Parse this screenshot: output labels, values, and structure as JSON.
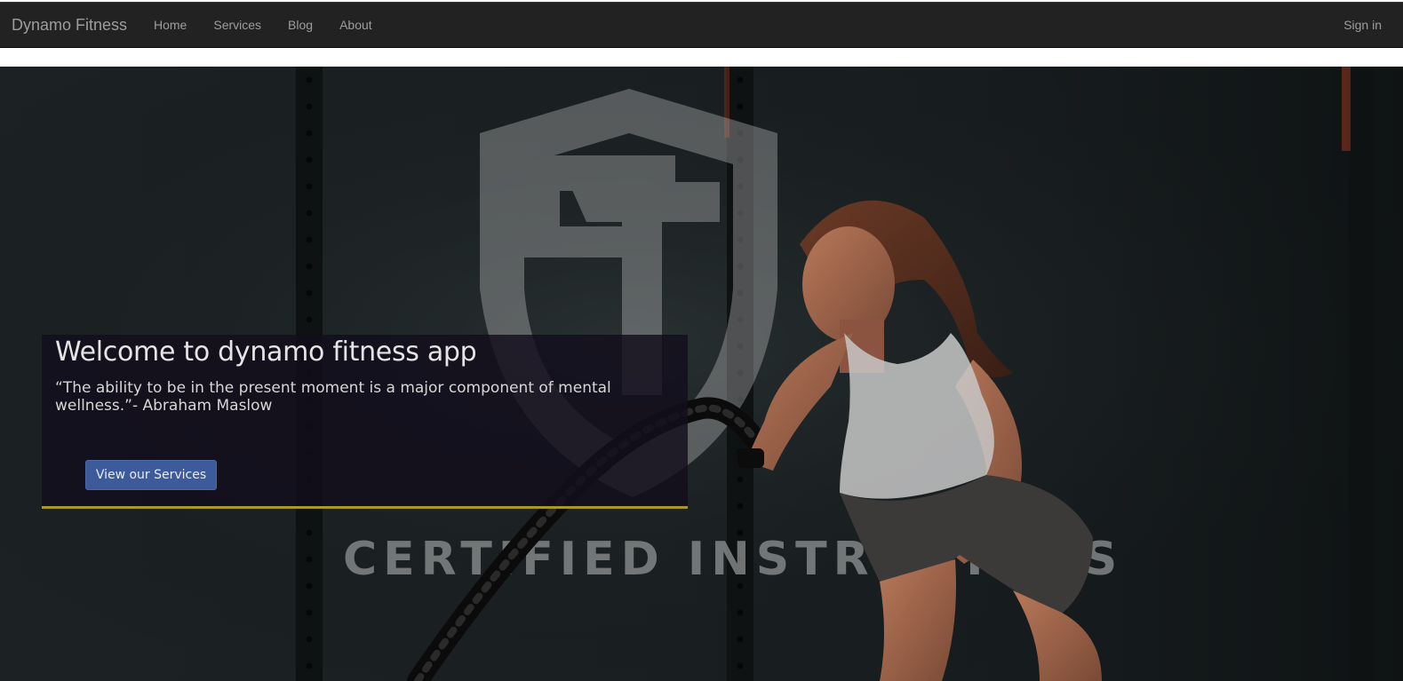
{
  "navbar": {
    "brand": "Dynamo Fitness",
    "links": [
      {
        "label": "Home"
      },
      {
        "label": "Services"
      },
      {
        "label": "Blog"
      },
      {
        "label": "About"
      }
    ],
    "signin_label": "Sign in"
  },
  "hero": {
    "background_text": "CERTIFIED INSTRUCTORS",
    "title": "Welcome to dynamo fitness app",
    "quote": "“The ability to be in the present moment is a major component of mental wellness.”- Abraham Maslow",
    "button_label": "View our Services"
  },
  "colors": {
    "navbar_bg": "#222222",
    "nav_text": "#9d9d9d",
    "panel_accent": "#a8972c",
    "button_bg": "#3d5a9a"
  }
}
